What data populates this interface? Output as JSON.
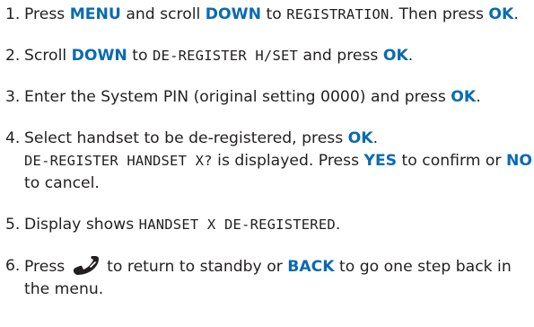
{
  "steps": [
    {
      "number": "1.",
      "parts": [
        {
          "t": "text",
          "v": "Press "
        },
        {
          "t": "key",
          "v": "MENU"
        },
        {
          "t": "text",
          "v": " and scroll "
        },
        {
          "t": "key",
          "v": "DOWN"
        },
        {
          "t": "text",
          "v": " to "
        },
        {
          "t": "lcd",
          "v": "REGISTRATION"
        },
        {
          "t": "text",
          "v": ". Then press "
        },
        {
          "t": "key",
          "v": "OK"
        },
        {
          "t": "text",
          "v": "."
        }
      ]
    },
    {
      "number": "2.",
      "parts": [
        {
          "t": "text",
          "v": "Scroll "
        },
        {
          "t": "key",
          "v": "DOWN"
        },
        {
          "t": "text",
          "v": " to "
        },
        {
          "t": "lcd",
          "v": "DE-REGISTER H/SET"
        },
        {
          "t": "text",
          "v": " and press "
        },
        {
          "t": "key",
          "v": "OK"
        },
        {
          "t": "text",
          "v": "."
        }
      ]
    },
    {
      "number": "3.",
      "parts": [
        {
          "t": "text",
          "v": "Enter the System PIN (original setting 0000) and press "
        },
        {
          "t": "key",
          "v": "OK"
        },
        {
          "t": "text",
          "v": "."
        }
      ]
    },
    {
      "number": "4.",
      "parts": [
        {
          "t": "text",
          "v": "Select handset to be de-registered, press "
        },
        {
          "t": "key",
          "v": "OK"
        },
        {
          "t": "text",
          "v": "."
        },
        {
          "t": "br"
        },
        {
          "t": "lcd",
          "v": "DE-REGISTER HANDSET X?"
        },
        {
          "t": "text",
          "v": " is displayed. Press "
        },
        {
          "t": "key",
          "v": "YES"
        },
        {
          "t": "text",
          "v": " to confirm or "
        },
        {
          "t": "key",
          "v": "NO"
        },
        {
          "t": "text",
          "v": " to cancel."
        }
      ]
    },
    {
      "number": "5.",
      "parts": [
        {
          "t": "text",
          "v": "Display shows "
        },
        {
          "t": "lcd",
          "v": "HANDSET X DE-REGISTERED"
        },
        {
          "t": "text",
          "v": "."
        }
      ]
    },
    {
      "number": "6.",
      "parts": [
        {
          "t": "text",
          "v": "Press "
        },
        {
          "t": "icon",
          "v": "end-call-handset-icon"
        },
        {
          "t": "text",
          "v": " to return to standby or "
        },
        {
          "t": "key",
          "v": "BACK"
        },
        {
          "t": "text",
          "v": " to go one step back in the menu."
        }
      ]
    }
  ],
  "colors": {
    "key": "#0a6ab3",
    "text": "#231f20"
  }
}
